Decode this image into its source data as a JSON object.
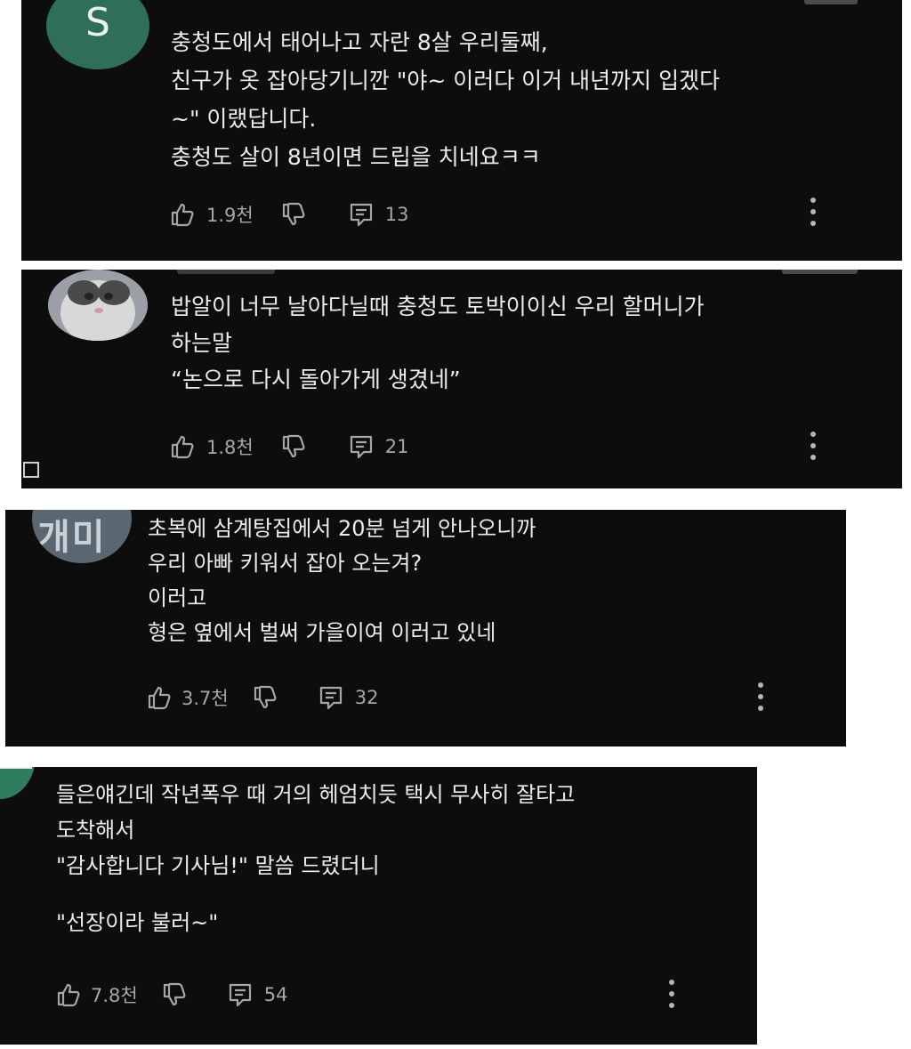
{
  "comments": [
    {
      "avatar_letter": "S",
      "avatar_color": "#2f6f57",
      "lines": [
        "충청도에서 태어나고 자란 8살 우리둘째,",
        "친구가 옷 잡아당기니깐 \"야~ 이러다 이거 내년까지 입겠다",
        "~\" 이랬답니다.",
        "충청도 살이 8년이면 드립을 치네요ㅋㅋ"
      ],
      "likes": "1.9천",
      "replies": "13"
    },
    {
      "avatar_color": "#8a8f96",
      "lines": [
        "밥알이 너무 날아다닐때 충청도 토박이이신 우리 할머니가",
        "하는말",
        "“논으로 다시 돌아가게 생겼네”"
      ],
      "likes": "1.8천",
      "replies": "21"
    },
    {
      "avatar_text": "개미",
      "avatar_color": "#5b6770",
      "lines": [
        "초복에 삼계탕집에서 20분 넘게 안나오니까",
        "우리 아빠 키워서 잡아 오는겨?",
        "이러고",
        "형은 옆에서 벌써 가을이여 이러고 있네"
      ],
      "likes": "3.7천",
      "replies": "32"
    },
    {
      "avatar_color": "#2e7d5e",
      "lines": [
        "들은얘긴데 작년폭우 때 거의 헤엄치듯 택시 무사히 잘타고",
        "도착해서",
        "\"감사합니다 기사님!\" 말씀 드렸더니",
        "",
        "\"선장이라 불러~\""
      ],
      "likes": "7.8천",
      "replies": "54"
    }
  ]
}
